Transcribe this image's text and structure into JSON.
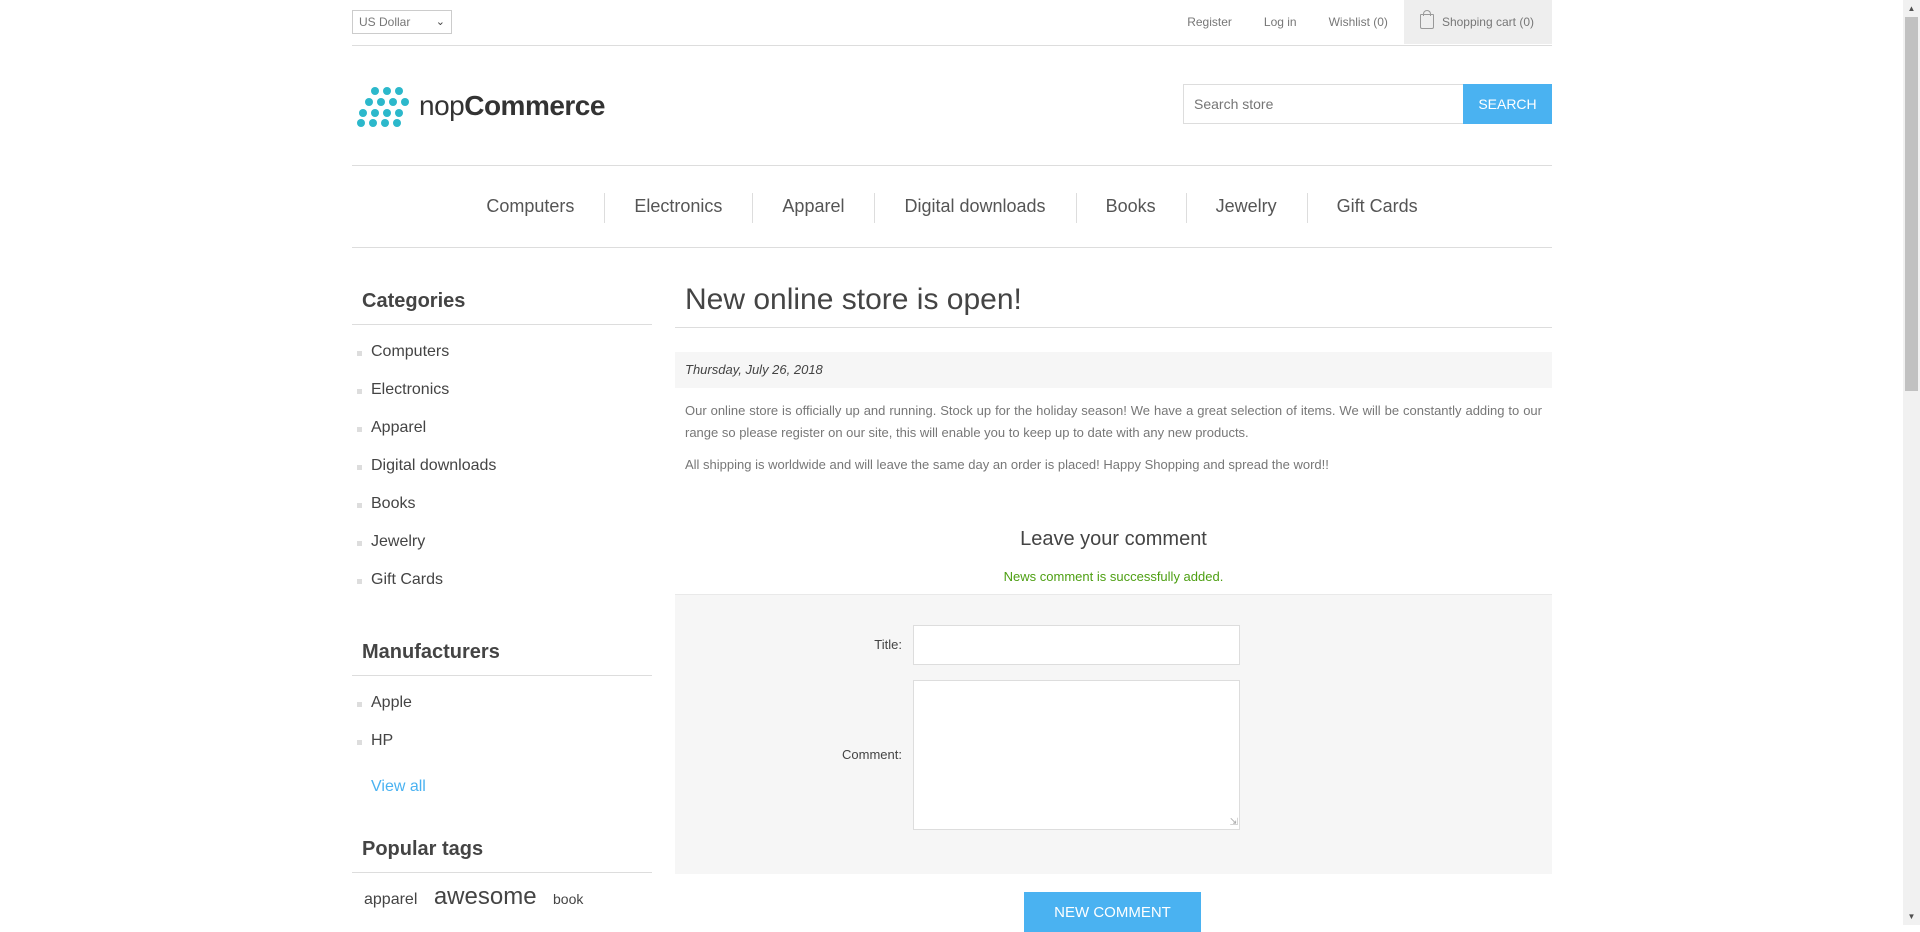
{
  "header": {
    "currency": "US Dollar",
    "links": {
      "register": "Register",
      "login": "Log in",
      "wishlist": "Wishlist (0)",
      "cart": "Shopping cart (0)"
    },
    "logo": {
      "light": "nop",
      "bold": "Commerce",
      "color": "#2cb8cb"
    },
    "search": {
      "placeholder": "Search store",
      "button": "Search"
    }
  },
  "menu": [
    "Computers",
    "Electronics",
    "Apparel",
    "Digital downloads",
    "Books",
    "Jewelry",
    "Gift Cards"
  ],
  "sidebar": {
    "categories": {
      "title": "Categories",
      "items": [
        "Computers",
        "Electronics",
        "Apparel",
        "Digital downloads",
        "Books",
        "Jewelry",
        "Gift Cards"
      ]
    },
    "manufacturers": {
      "title": "Manufacturers",
      "items": [
        "Apple",
        "HP"
      ],
      "view_all": "View all"
    },
    "tags": {
      "title": "Popular tags",
      "items": [
        "apparel",
        "awesome",
        "book"
      ]
    }
  },
  "news": {
    "title": "New online store is open!",
    "date": "Thursday, July 26, 2018",
    "paragraphs": [
      "Our online store is officially up and running. Stock up for the holiday season! We have a great selection of items. We will be constantly adding to our range so please register on our site, this will enable you to keep up to date with any new products.",
      "All shipping is worldwide and will leave the same day an order is placed! Happy Shopping and spread the word!!"
    ]
  },
  "comment_form": {
    "heading": "Leave your comment",
    "result": "News comment is successfully added.",
    "title_label": "Title:",
    "comment_label": "Comment:",
    "title_value": "",
    "comment_value": "",
    "submit": "New comment"
  },
  "colors": {
    "accent": "#4ab2f1",
    "success": "#4d9f12"
  }
}
